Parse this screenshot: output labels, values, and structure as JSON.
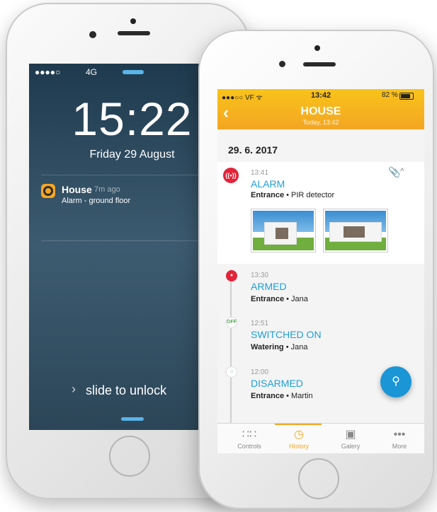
{
  "lock_screen": {
    "status": {
      "signal": "●●●●○",
      "network": "4G",
      "location": "➤",
      "bluetooth": "✱"
    },
    "time": "15:22",
    "date": "Friday 29 August",
    "notification": {
      "app": "House",
      "age": "7m ago",
      "message": "Alarm - ground floor"
    },
    "slide_text": "slide to unlock",
    "slide_arrow": "›"
  },
  "app": {
    "status": {
      "carrier": "●●●○○ VF ᯤ",
      "time": "13:42",
      "battery": "82 %"
    },
    "header": {
      "back": "‹",
      "title": "HOUSE",
      "subtitle": "Today, 13:42"
    },
    "date_heading": "29. 6. 2017",
    "events": [
      {
        "time": "13:41",
        "title": "ALARM",
        "location": "Entrance",
        "detail": " • PIR detector",
        "icon": "alarm-icon"
      },
      {
        "time": "13:30",
        "title": "ARMED",
        "location": "Entrance",
        "detail": " • Jana",
        "icon": "lock-icon"
      },
      {
        "time": "12:51",
        "title": "SWITCHED ON",
        "location": "Watering",
        "detail": " • Jana",
        "icon": "off-badge",
        "badge": "OFF"
      },
      {
        "time": "12:00",
        "title": "DISARMED",
        "location": "Entrance",
        "detail": " • Martin",
        "icon": "unlock-icon"
      }
    ],
    "tabs": [
      {
        "label": "Controls",
        "icon": "grid-icon"
      },
      {
        "label": "History",
        "icon": "clock-icon"
      },
      {
        "label": "Galery",
        "icon": "camera-icon"
      },
      {
        "label": "More",
        "icon": "more-icon"
      }
    ],
    "active_tab": "History",
    "colors": {
      "accent": "#f4a523",
      "link": "#1fa0d8",
      "alarm": "#e2233a",
      "fab": "#1a95d6"
    }
  }
}
